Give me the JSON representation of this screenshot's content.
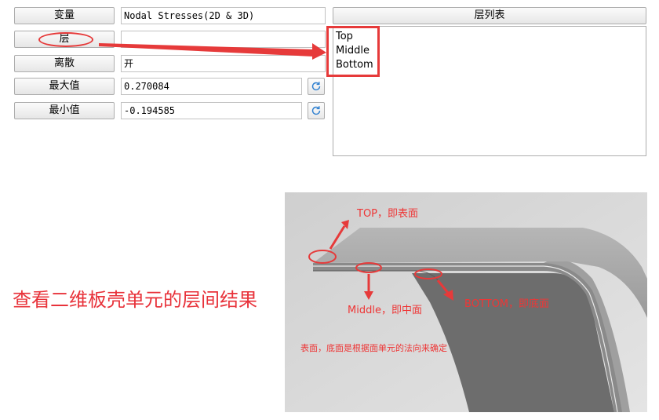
{
  "panel": {
    "rows": [
      {
        "button": "变量",
        "value": "Nodal Stresses(2D & 3D)"
      },
      {
        "button": "层",
        "value": ""
      },
      {
        "button": "离散",
        "value": "开"
      },
      {
        "button": "最大值",
        "value": "0.270084"
      },
      {
        "button": "最小值",
        "value": "-0.194585"
      }
    ],
    "refresh_icon": "refresh-icon"
  },
  "layer_list": {
    "header": "层列表",
    "items": [
      "Top",
      "Middle",
      "Bottom"
    ]
  },
  "caption": "查看二维板壳单元的层间结果",
  "illustration": {
    "labels": {
      "top": "TOP，即表面",
      "middle": "Middle，即中面",
      "bottom": "BOTTOM，即底面",
      "note": "表面，底面是根据面单元的法向来确定"
    }
  },
  "colors": {
    "annotation_red": "#e63a3a",
    "shell_dark": "#6b6b6b",
    "shell_light": "#a7a7a7"
  }
}
